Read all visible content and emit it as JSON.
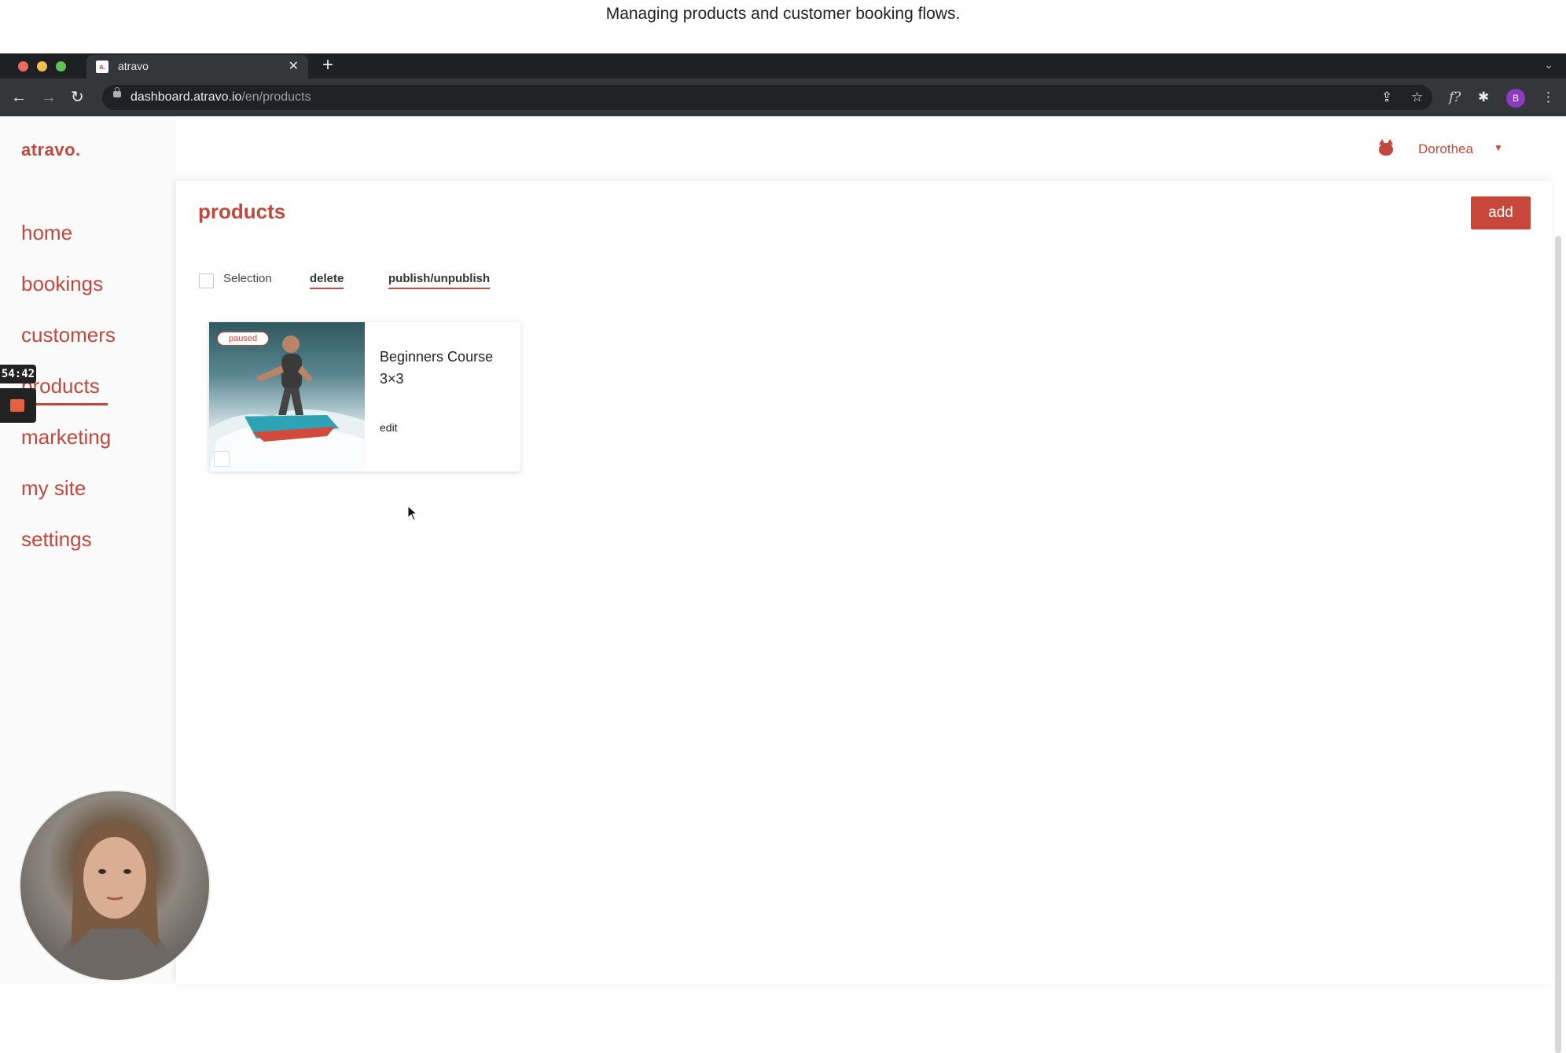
{
  "caption": "Managing products and customer booking flows.",
  "browser": {
    "tab_title": "atravo",
    "tab_favicon": "a.",
    "url_domain": "dashboard.atravo.io",
    "url_path": "/en/products",
    "profile_initial": "B",
    "icons": [
      "back-icon",
      "forward-icon",
      "reload-icon",
      "lock-icon",
      "share-icon",
      "star-icon",
      "function-icon",
      "extensions-icon",
      "menu-icon"
    ]
  },
  "app": {
    "logo": "atravo.",
    "user_name": "Dorothea",
    "brand_color": "#c0483c"
  },
  "sidebar": {
    "items": [
      {
        "label": "home"
      },
      {
        "label": "bookings"
      },
      {
        "label": "customers"
      },
      {
        "label": "products",
        "active": true
      },
      {
        "label": "marketing"
      },
      {
        "label": "my site"
      },
      {
        "label": "settings"
      }
    ]
  },
  "recorder": {
    "time": "54:42"
  },
  "main": {
    "title": "products",
    "add_label": "add",
    "selection_label": "Selection",
    "delete_label": "delete",
    "publish_label": "publish/unpublish",
    "products": [
      {
        "title": "Beginners Course 3×3",
        "status": "paused",
        "edit_label": "edit"
      }
    ]
  }
}
